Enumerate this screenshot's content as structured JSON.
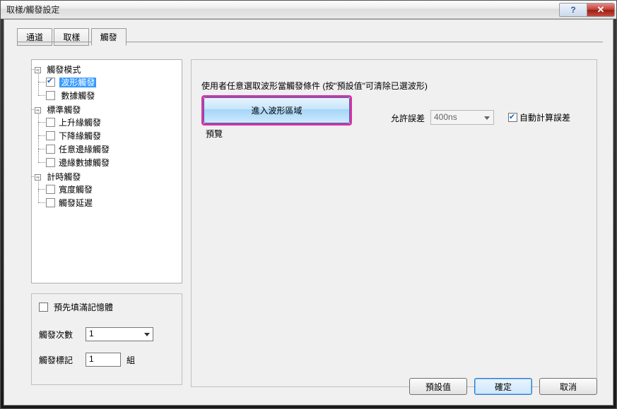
{
  "window": {
    "title": "取樣/觸發設定"
  },
  "tabs": {
    "items": [
      "通道",
      "取樣",
      "觸發"
    ],
    "active_index": 2
  },
  "tree": {
    "groups": [
      {
        "label": "觸發模式",
        "items": [
          {
            "label": "波形觸發",
            "checked": true,
            "selected": true
          },
          {
            "label": "數據觸發",
            "checked": false
          }
        ]
      },
      {
        "label": "標準觸發",
        "items": [
          {
            "label": "上升緣觸發",
            "checked": false
          },
          {
            "label": "下降緣觸發",
            "checked": false
          },
          {
            "label": "任意邊緣觸發",
            "checked": false
          },
          {
            "label": "邊緣數據觸發",
            "checked": false
          }
        ]
      },
      {
        "label": "計時觸發",
        "items": [
          {
            "label": "寬度觸發",
            "checked": false
          },
          {
            "label": "觸發延遲",
            "checked": false
          }
        ]
      }
    ]
  },
  "right": {
    "instruction": "使用者任意選取波形當觸發條件 (按\"預設值\"可清除已選波形)",
    "enter_waveform_btn": "進入波形區域",
    "preview_label": "預覽",
    "tolerance_label": "允許誤差",
    "tolerance_value": "400ns",
    "auto_tolerance_label": "自動計算誤差",
    "auto_tolerance_checked": true
  },
  "bottom_left": {
    "prefill_label": "預先填滿記憶體",
    "prefill_checked": false,
    "count_label": "觸發次數",
    "count_value": "1",
    "mark_label": "觸發標記",
    "mark_value": "1",
    "mark_unit": "組"
  },
  "footer": {
    "defaults": "預設值",
    "ok": "確定",
    "cancel": "取消"
  }
}
